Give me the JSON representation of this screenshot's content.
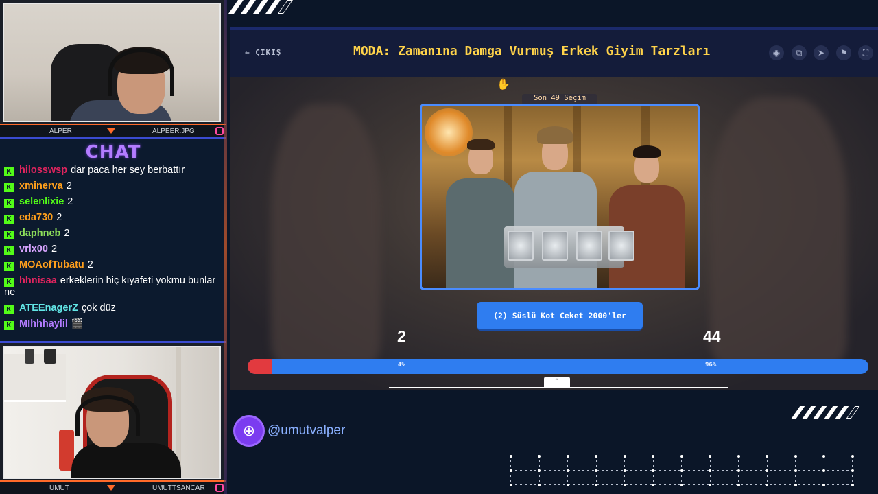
{
  "webcams": {
    "top": {
      "left_label": "ALPER",
      "right_label": "ALPEER.JPG"
    },
    "bottom": {
      "left_label": "UMUT",
      "right_label": "UMUTTSANCAR"
    }
  },
  "chat": {
    "title": "CHAT",
    "badge": "K",
    "messages": [
      {
        "user": "hilosswsp",
        "color": "#e0245e",
        "text": "dar paca her sey berbattır"
      },
      {
        "user": "xminerva",
        "color": "#ff9f1c",
        "text": "2"
      },
      {
        "user": "selenlixie",
        "color": "#53fc18",
        "text": "2"
      },
      {
        "user": "eda730",
        "color": "#ff9f1c",
        "text": "2"
      },
      {
        "user": "daphneb",
        "color": "#8ee05a",
        "text": "2"
      },
      {
        "user": "vrlx00",
        "color": "#d8a4ff",
        "text": "2"
      },
      {
        "user": "MOAofTubatu",
        "color": "#ff9f1c",
        "text": "2"
      },
      {
        "user": "hhnisaa",
        "color": "#e0245e",
        "text": "erkeklerin hiç kıyafeti yokmu bunlar ne"
      },
      {
        "user": "ATEEnagerZ",
        "color": "#62e6e6",
        "text": "çok düz"
      },
      {
        "user": "MIhhhaylil",
        "color": "#b37cff",
        "text": "🎬"
      }
    ]
  },
  "game": {
    "back_label": "← ÇIKIŞ",
    "title": "MODA: Zamanına Damga Vurmuş Erkek Giyim Tarzları",
    "controls": [
      "eye-icon",
      "share-icon",
      "send-icon",
      "flag-icon",
      "fullscreen-icon"
    ],
    "section_label": "Son 49 Seçim",
    "choice_label": "(2) Süslü Kot Ceket 2000'ler",
    "left_count": "2",
    "right_count": "44",
    "left_pct_label": "4%",
    "right_pct_label": "96%",
    "left_share": 0.04,
    "colors": {
      "left": "#e23a3f",
      "right": "#2f7df0",
      "title": "#ffd34a"
    }
  },
  "social": {
    "handle": "@umutvalper"
  }
}
